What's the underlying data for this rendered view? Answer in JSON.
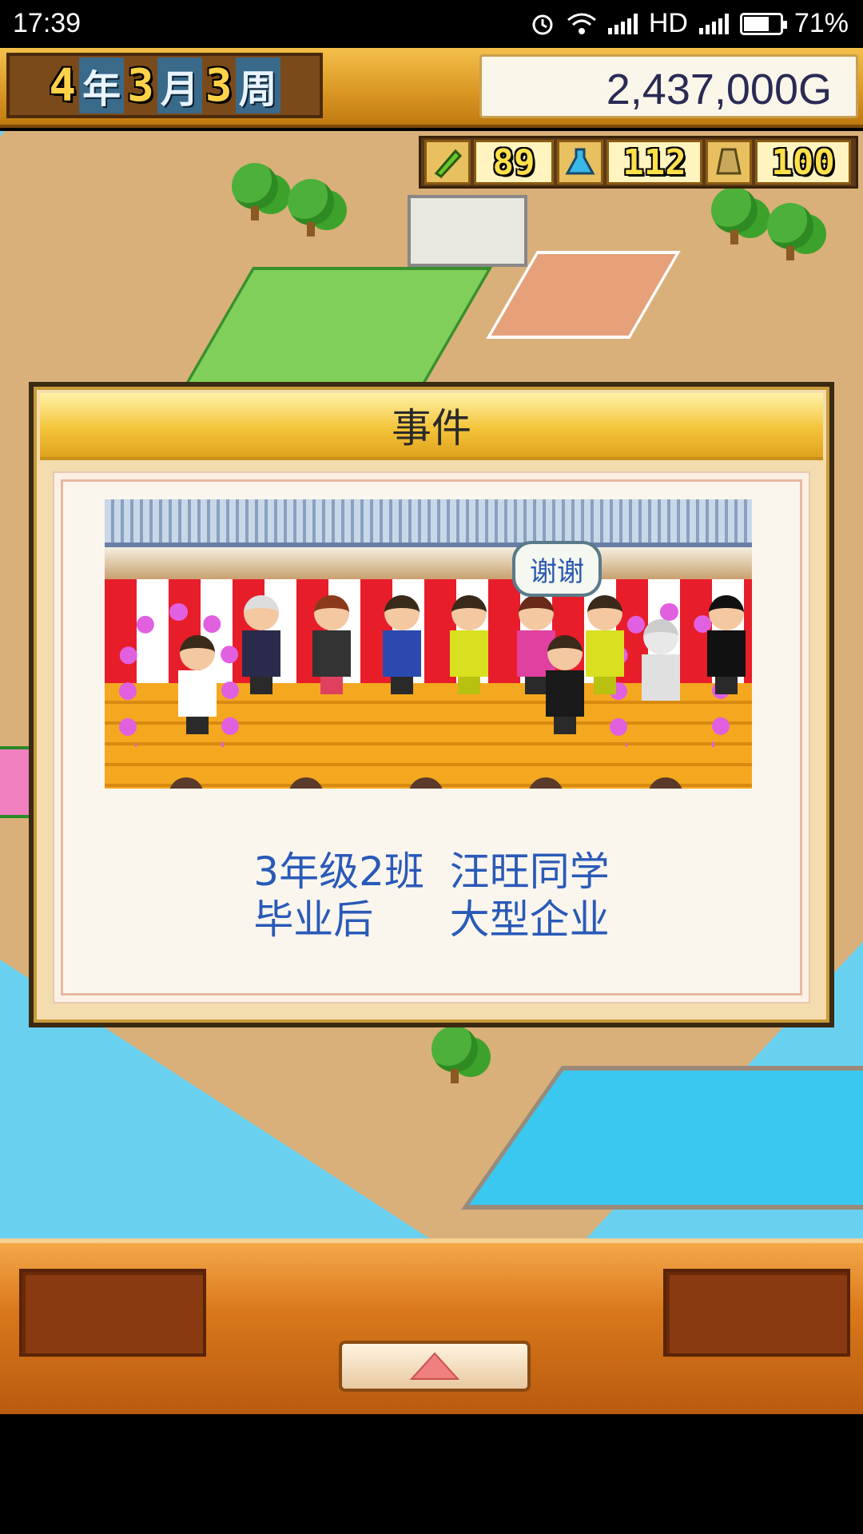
{
  "status_bar": {
    "time": "17:39",
    "network": "HD",
    "battery": "71%",
    "battery_level": 0.71,
    "icons": [
      "alarm-icon",
      "wifi-icon",
      "signal-icon",
      "signal-icon",
      "battery-icon"
    ]
  },
  "top_bar": {
    "year": "4",
    "year_unit": "年",
    "month": "3",
    "month_unit": "月",
    "week": "3",
    "week_unit": "周",
    "money": "2,437,000G"
  },
  "stats": [
    {
      "icon": "pencil-icon",
      "value": "89"
    },
    {
      "icon": "flask-icon",
      "value": "112"
    },
    {
      "icon": "trophy-icon",
      "value": "100"
    }
  ],
  "dialog": {
    "title": "事件",
    "speech": "谢谢",
    "message_line1": "3年级2班  汪旺同学",
    "message_line2": "毕业后      大型企业"
  },
  "bottom_bar": {
    "up_button_icon": "triangle-up-icon"
  },
  "colors": {
    "gold": "#f4c43a",
    "message_blue": "#2a5ab8",
    "panel_orange": "#d9781a"
  }
}
